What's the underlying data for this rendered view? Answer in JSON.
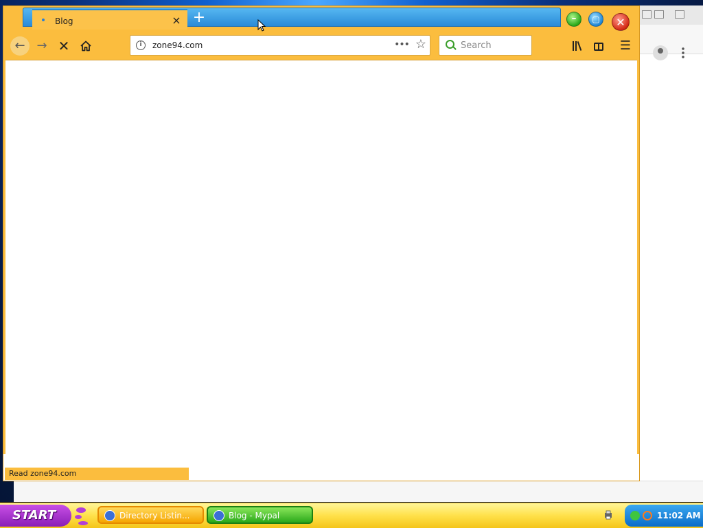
{
  "browser": {
    "tab": {
      "title": "Blog",
      "close_label": "×"
    },
    "new_tab_label": "+",
    "url": "zone94.com",
    "page_actions_label": "•••",
    "search_placeholder": "Search",
    "status_text": "Read zone94.com",
    "icons": {
      "back": "back-arrow-icon",
      "forward": "forward-arrow-icon",
      "stop": "stop-icon",
      "home": "home-icon",
      "info": "info-icon",
      "bookmark": "star-icon",
      "library": "library-icon",
      "sidebar": "sidebar-icon",
      "menu": "hamburger-menu-icon"
    },
    "theme_color": "#fbbd3e"
  },
  "taskbar": {
    "start_label": "START",
    "tasks": [
      {
        "label": "Directory Listin...",
        "active": false
      },
      {
        "label": "Blog - Mypal",
        "active": true
      }
    ],
    "clock": "11:02 AM"
  }
}
